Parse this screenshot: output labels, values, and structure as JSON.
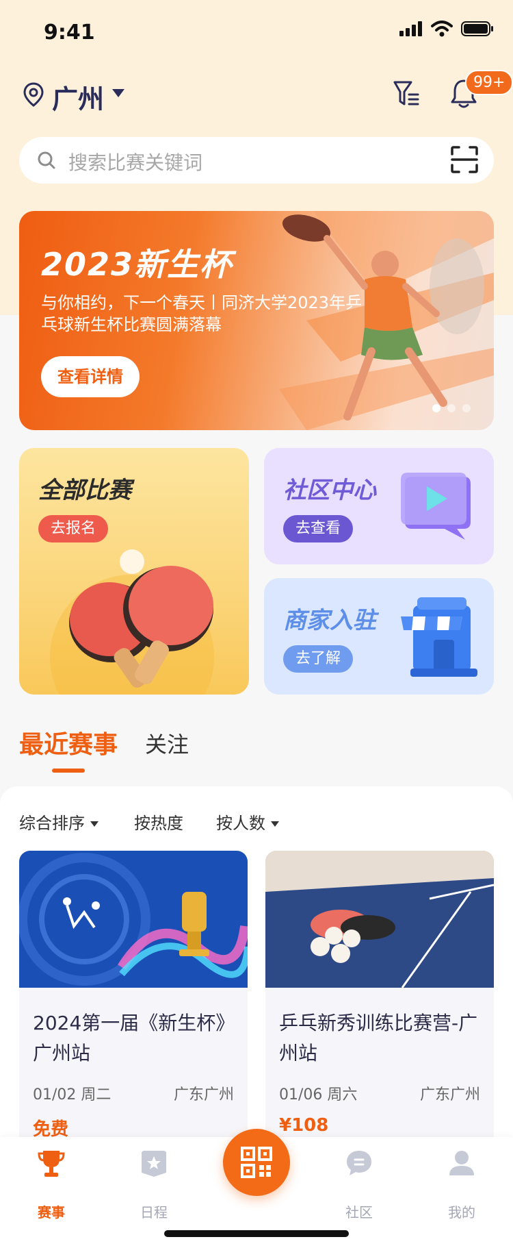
{
  "status": {
    "time": "9:41"
  },
  "header": {
    "city": "广州",
    "notification_badge": "99+"
  },
  "search": {
    "placeholder": "搜索比赛关键词"
  },
  "banner": {
    "title": "2023新生杯",
    "subtitle": "与你相约，下一个春天丨同济大学2023年乒乓球新生杯比赛圆满落幕",
    "button": "查看详情",
    "slides": 3,
    "active_slide": 1
  },
  "cards": {
    "all": {
      "title": "全部比赛",
      "button": "去报名"
    },
    "community": {
      "title": "社区中心",
      "button": "去查看"
    },
    "merchant": {
      "title": "商家入驻",
      "button": "去了解"
    }
  },
  "tabs": {
    "recent": "最近赛事",
    "follow": "关注"
  },
  "sorts": {
    "overall": "综合排序",
    "popularity": "按热度",
    "people": "按人数"
  },
  "events": [
    {
      "title": "2024第一届《新生杯》广州站",
      "date": "01/02 周二",
      "place": "广东广州",
      "price": "免费"
    },
    {
      "title": "乒乓新秀训练比赛营-广州站",
      "date": "01/06 周六",
      "place": "广东广州",
      "price": "¥108"
    }
  ],
  "tabbar": {
    "matches": "赛事",
    "schedule": "日程",
    "community": "社区",
    "mine": "我的"
  },
  "colors": {
    "accent": "#EE5F12",
    "nav_text": "#2A2D5A",
    "inactive": "#A4A6B5"
  }
}
